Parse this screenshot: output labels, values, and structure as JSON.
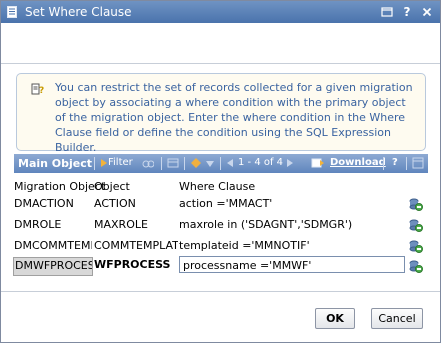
{
  "window": {
    "title": "Set Where Clause",
    "controls": [
      "restore-icon",
      "help-icon",
      "close-icon"
    ]
  },
  "info": {
    "icon": "hint-icon",
    "text": "You can restrict the set of records collected for a given migration object by associating a where condition with the primary object of the migration object. Enter the where condition in the Where Clause field or define the condition using the SQL Expression Builder."
  },
  "toolbar": {
    "title": "Main Object",
    "filter_label": "Filter",
    "pager": "1 - 4 of 4",
    "download_label": "Download",
    "help_label": "?"
  },
  "table": {
    "columns": [
      "Migration Object",
      "Object",
      "Where Clause"
    ],
    "rows": [
      {
        "migration_object": "DMACTION",
        "object": "ACTION",
        "where_clause": "action ='MMACT'"
      },
      {
        "migration_object": "DMROLE",
        "object": "MAXROLE",
        "where_clause": "maxrole in ('SDAGNT','SDMGR')"
      },
      {
        "migration_object": "DMCOMMTEMPL",
        "object": "COMMTEMPLATE",
        "where_clause": "templateid ='MMNOTIF'"
      },
      {
        "migration_object": "DMWFPROCESS",
        "object": "WFPROCESS",
        "where_clause": "processname ='MMWF'"
      }
    ],
    "row_icon": "sql-expression-builder-icon"
  },
  "buttons": {
    "ok": "OK",
    "cancel": "Cancel"
  },
  "colors": {
    "titlebar": "#5a80b5",
    "toolbar": "#7597c8",
    "info_text": "#3a63a0",
    "info_bg": "#fefbf0"
  }
}
